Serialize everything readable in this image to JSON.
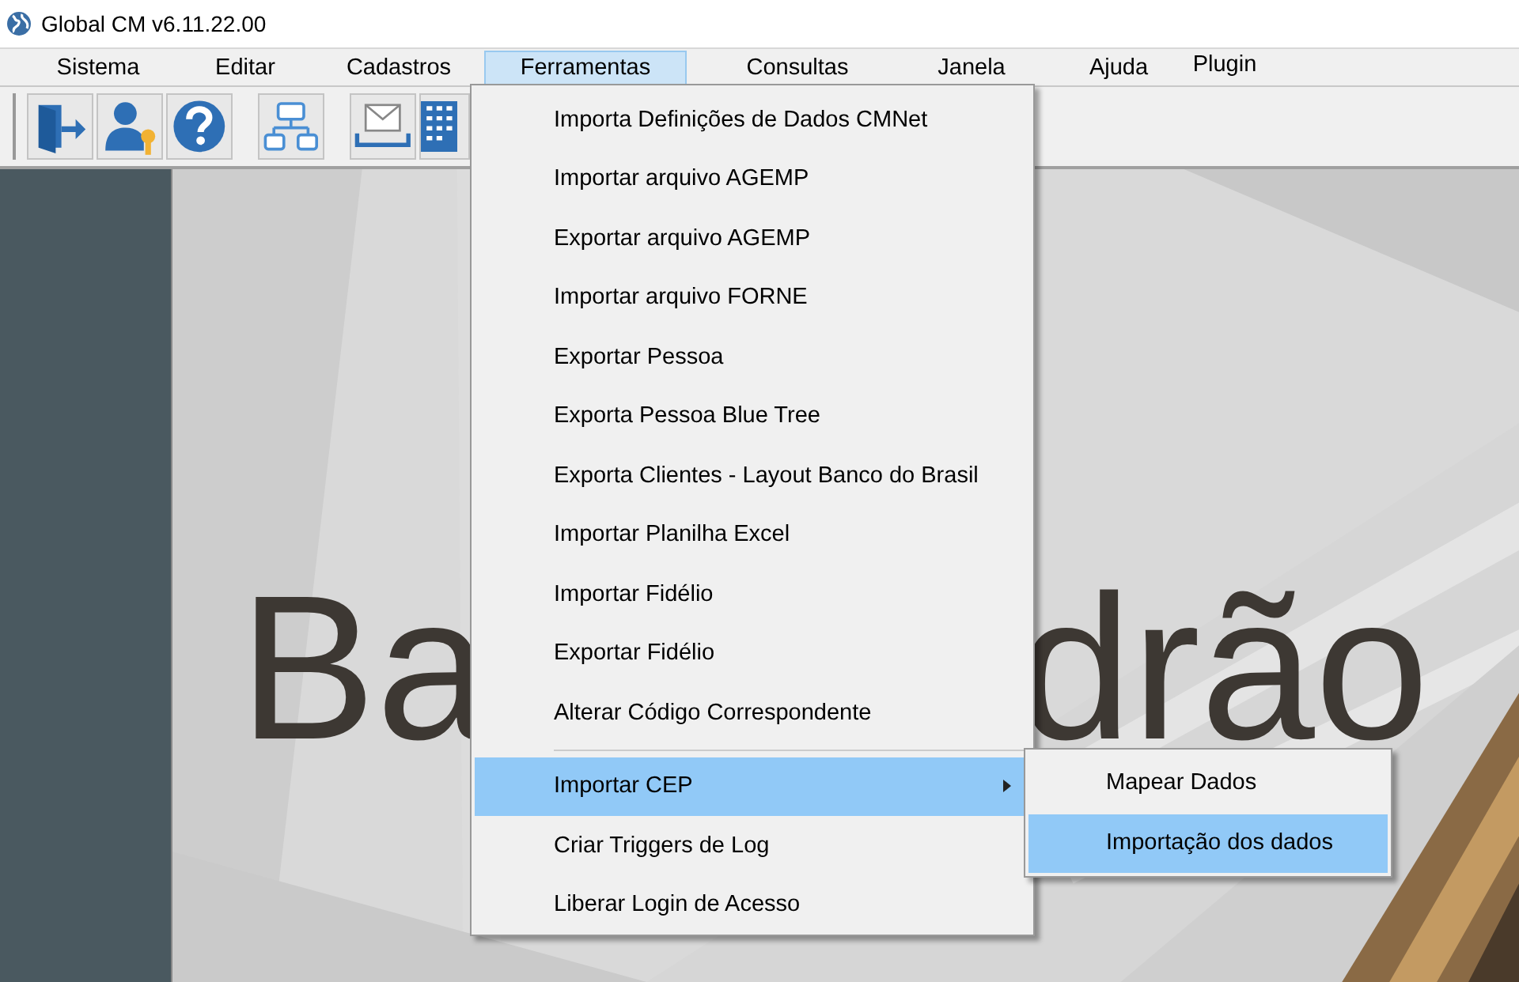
{
  "window": {
    "title": "Global CM v6.11.22.00"
  },
  "menubar": [
    {
      "label": "Sistema",
      "selected": false
    },
    {
      "label": "Editar",
      "selected": false
    },
    {
      "label": "Cadastros",
      "selected": false
    },
    {
      "label": "Ferramentas",
      "selected": true
    },
    {
      "label": "Consultas",
      "selected": false
    },
    {
      "label": "Janela",
      "selected": false
    },
    {
      "label": "Ajuda",
      "selected": false
    },
    {
      "label": "Plugin",
      "selected": false
    }
  ],
  "toolbar": [
    {
      "kind": "exit"
    },
    {
      "kind": "user-key"
    },
    {
      "kind": "help"
    },
    {
      "kind": "gap"
    },
    {
      "kind": "org"
    },
    {
      "kind": "gap"
    },
    {
      "kind": "mail"
    },
    {
      "kind": "building"
    }
  ],
  "background": {
    "kind": "picture",
    "title_left": "Ba",
    "title_right": "drão"
  },
  "menu": [
    {
      "kind": "item",
      "label": "Importa Definições de Dados CMNet",
      "selected": false
    },
    {
      "kind": "item",
      "label": "Importar arquivo AGEMP",
      "selected": false
    },
    {
      "kind": "item",
      "label": "Exportar arquivo AGEMP",
      "selected": false
    },
    {
      "kind": "item",
      "label": "Importar arquivo FORNE",
      "selected": false
    },
    {
      "kind": "item",
      "label": "Exportar Pessoa",
      "selected": false
    },
    {
      "kind": "item",
      "label": "Exporta Pessoa Blue Tree",
      "selected": false
    },
    {
      "kind": "item",
      "label": "Exporta Clientes - Layout Banco do Brasil",
      "selected": false
    },
    {
      "kind": "item",
      "label": "Importar Planilha Excel",
      "selected": false
    },
    {
      "kind": "item",
      "label": "Importar Fidélio",
      "selected": false
    },
    {
      "kind": "item",
      "label": "Exportar Fidélio",
      "selected": false
    },
    {
      "kind": "item",
      "label": "Alterar Código Correspondente",
      "selected": false
    },
    {
      "kind": "separator"
    },
    {
      "kind": "submenu",
      "label": "Importar CEP",
      "selected": true,
      "expanded": true,
      "children": [
        {
          "label": "Mapear Dados",
          "selected": false
        },
        {
          "label": "Importação dos dados",
          "selected": true
        }
      ]
    },
    {
      "kind": "item",
      "label": "Criar Triggers de Log",
      "selected": false
    },
    {
      "kind": "item",
      "label": "Liberar Login de Acesso",
      "selected": false
    }
  ]
}
